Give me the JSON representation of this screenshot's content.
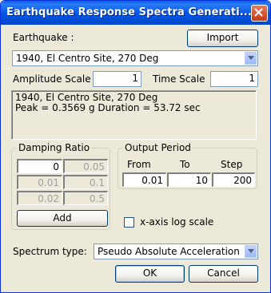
{
  "window": {
    "title": "Earthquake Response Spectra Generati..."
  },
  "earthquake": {
    "label": "Earthquake :",
    "import_label": "Import",
    "selected": "1940, El Centro Site, 270 Deg"
  },
  "scales": {
    "amplitude_label": "Amplitude Scale",
    "amplitude_value": "1",
    "time_label": "Time Scale",
    "time_value": "1"
  },
  "info": {
    "line1": "1940, El Centro Site, 270 Deg",
    "line2": "Peak = 0.3569 g  Duration = 53.72 sec"
  },
  "damping": {
    "title": "Damping Ratio",
    "values": [
      "0",
      "0.05",
      "0.01",
      "0.1",
      "0.02",
      "0.5"
    ],
    "add_label": "Add"
  },
  "output_period": {
    "title": "Output Period",
    "from_label": "From",
    "to_label": "To",
    "step_label": "Step",
    "from_value": "0.01",
    "to_value": "10",
    "step_value": "200"
  },
  "log_scale": {
    "label": "x-axis log scale",
    "checked": false
  },
  "spectrum": {
    "label": "Spectrum type:",
    "selected": "Pseudo Absolute Acceleration"
  },
  "footer": {
    "ok_label": "OK",
    "cancel_label": "Cancel"
  }
}
